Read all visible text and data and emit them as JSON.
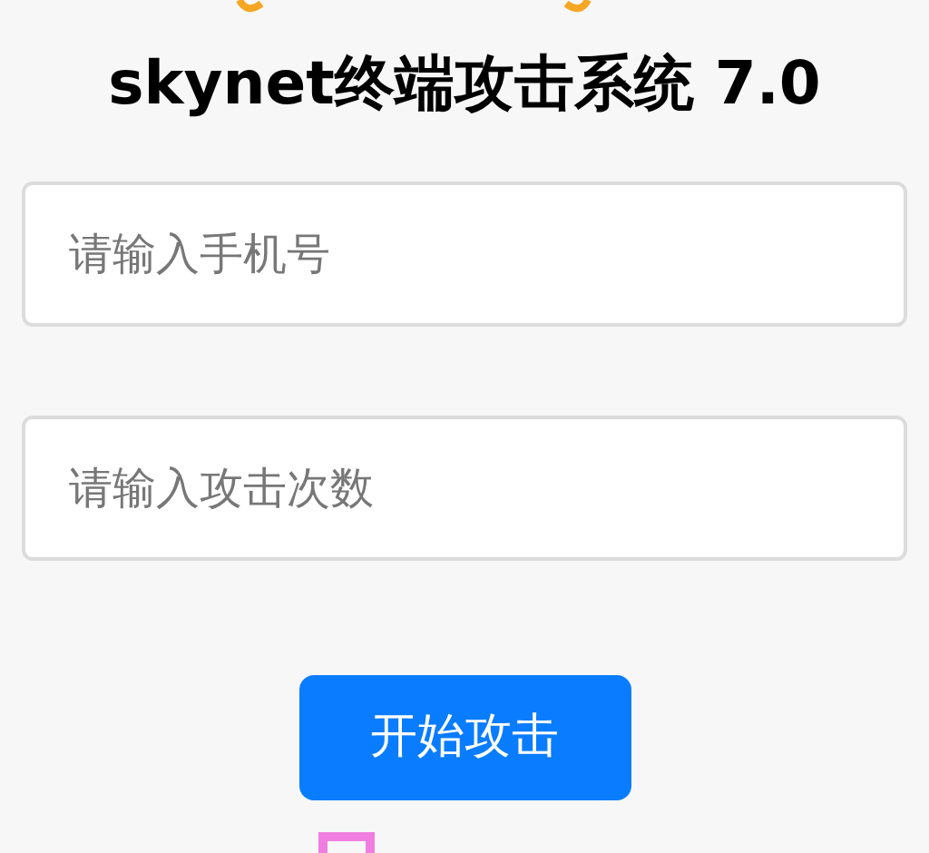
{
  "title": "skynet终端攻击系统 7.0",
  "fields": [
    {
      "placeholder": "请输入手机号"
    },
    {
      "placeholder": "请输入攻击次数"
    }
  ],
  "button": "开始攻击"
}
